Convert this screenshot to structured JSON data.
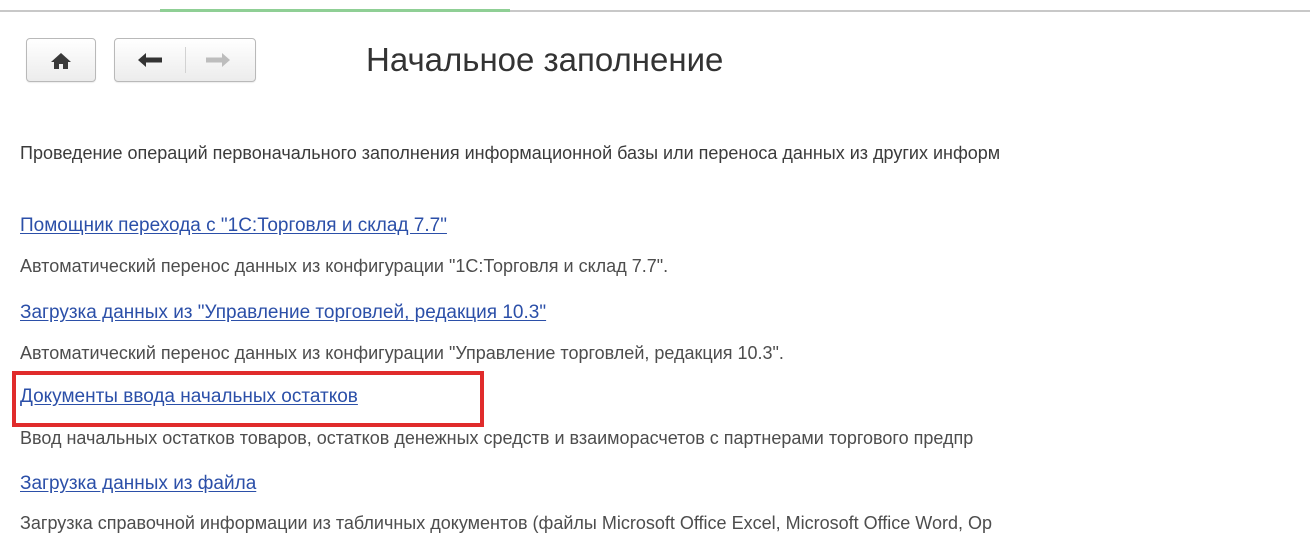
{
  "toolbar": {
    "home_icon": "home-icon",
    "back_icon": "arrow-left-icon",
    "forward_icon": "arrow-right-icon"
  },
  "page": {
    "title": "Начальное заполнение",
    "intro": "Проведение операций первоначального заполнения информационной базы или переноса данных из других информ"
  },
  "items": [
    {
      "link": "Помощник перехода с \"1С:Торговля и склад 7.7\"",
      "description": "Автоматический перенос данных из конфигурации \"1С:Торговля и склад 7.7\"."
    },
    {
      "link": "Загрузка данных из \"Управление торговлей, редакция 10.3\"",
      "description": "Автоматический перенос данных из конфигурации \"Управление торговлей, редакция 10.3\"."
    },
    {
      "link": "Документы ввода начальных остатков",
      "description": "Ввод начальных остатков товаров, остатков денежных средств и взаиморасчетов с партнерами торгового предпр",
      "highlighted": true
    },
    {
      "link": "Загрузка данных из файла",
      "description": "Загрузка справочной информации из табличных документов (файлы Microsoft Office Excel, Microsoft Office Word, Op"
    }
  ],
  "colors": {
    "link": "#2b4fa8",
    "highlight_frame": "#e02b2b",
    "description_text": "#4d4d4d"
  }
}
